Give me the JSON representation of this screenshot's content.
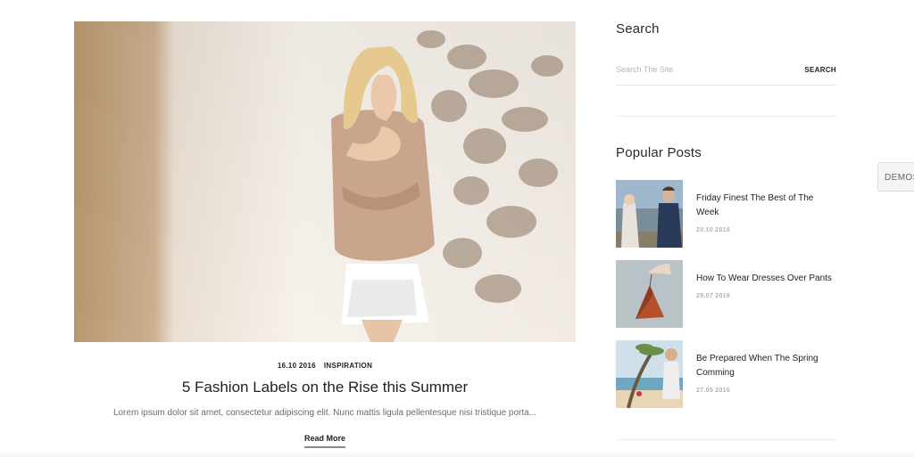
{
  "post": {
    "date": "16.10 2016",
    "category": "INSPIRATION",
    "title": "5 Fashion Labels on the Rise this Summer",
    "excerpt": "Lorem ipsum dolor sit amet, consectetur adipiscing elit. Nunc mattis ligula pellentesque nisi tristique porta...",
    "read_more": "Read More"
  },
  "sidebar": {
    "search": {
      "title": "Search",
      "placeholder": "Search The Site",
      "button": "SEARCH"
    },
    "popular": {
      "title": "Popular Posts",
      "items": [
        {
          "title": "Friday Finest The Best of The Week",
          "date": "20.10 2016"
        },
        {
          "title": "How To Wear Dresses Over Pants",
          "date": "29.07 2016"
        },
        {
          "title": "Be Prepared When The Spring Comming",
          "date": "27.05 2016"
        }
      ]
    }
  },
  "demos_tab": {
    "label": "DEMOS"
  },
  "colors": {
    "text": "#222222",
    "muted": "#6b6b6b",
    "date_grey": "#b2b2b2",
    "divider": "#e6e6e6",
    "photo_sand": "#c9ae8c",
    "photo_wall": "#efe7dd"
  }
}
